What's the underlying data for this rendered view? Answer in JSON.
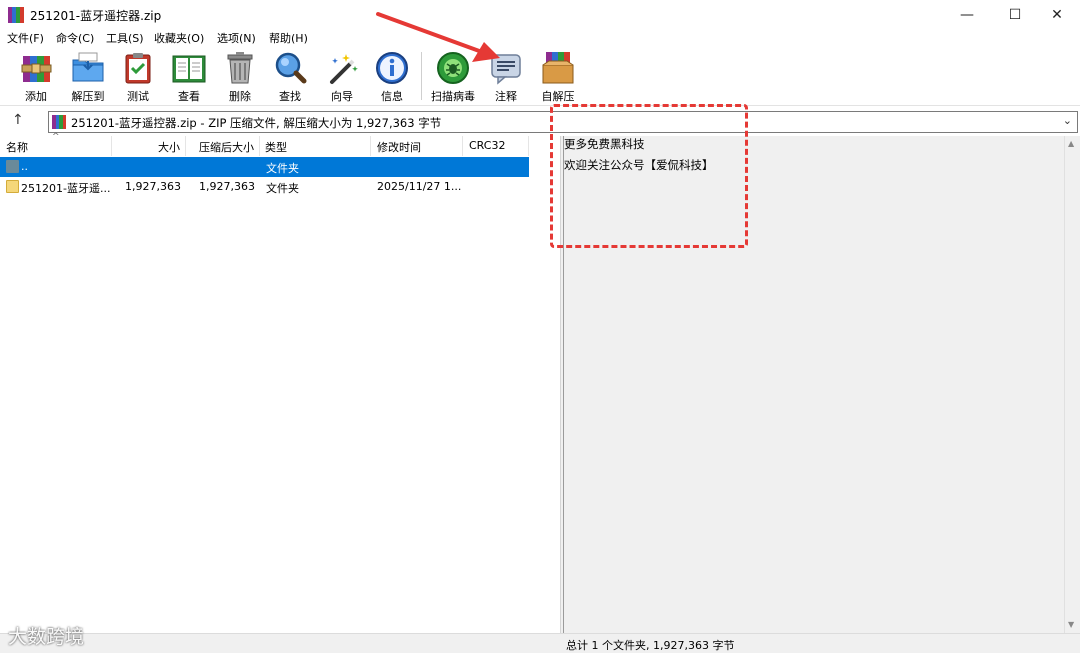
{
  "window": {
    "title": "251201-蓝牙遥控器.zip",
    "minimize_glyph": "—",
    "maximize_glyph": "☐",
    "close_glyph": "✕"
  },
  "menu": [
    "文件(F)",
    "命令(C)",
    "工具(S)",
    "收藏夹(O)",
    "选项(N)",
    "帮助(H)"
  ],
  "toolbar": [
    {
      "label": "添加",
      "icon": "add-archive-icon"
    },
    {
      "label": "解压到",
      "icon": "extract-folder-icon"
    },
    {
      "label": "测试",
      "icon": "test-clipboard-icon"
    },
    {
      "label": "查看",
      "icon": "view-book-icon"
    },
    {
      "label": "删除",
      "icon": "trash-icon"
    },
    {
      "label": "查找",
      "icon": "magnifier-icon"
    },
    {
      "label": "向导",
      "icon": "wizard-wand-icon"
    },
    {
      "label": "信息",
      "icon": "info-icon"
    },
    {
      "label": "扫描病毒",
      "icon": "virus-scan-icon"
    },
    {
      "label": "注释",
      "icon": "comment-icon"
    },
    {
      "label": "自解压",
      "icon": "sfx-box-icon"
    }
  ],
  "pathbar": {
    "up_glyph": "↑",
    "text": "251201-蓝牙遥控器.zip - ZIP 压缩文件, 解压缩大小为 1,927,363 字节",
    "dropdown_glyph": "⌄"
  },
  "columns": {
    "name": "名称",
    "size": "大小",
    "packed": "压缩后大小",
    "type": "类型",
    "modified": "修改时间",
    "crc": "CRC32",
    "sort_glyph": "^"
  },
  "rows": [
    {
      "name": "..",
      "size": "",
      "packed": "",
      "type": "文件夹",
      "modified": "",
      "crc": "",
      "selected": true
    },
    {
      "name": "251201-蓝牙遥...",
      "size": "1,927,363",
      "packed": "1,927,363",
      "type": "文件夹",
      "modified": "2025/11/27 1...",
      "crc": "",
      "selected": false
    }
  ],
  "comment": {
    "lines": [
      "更多免费黑科技",
      "欢迎关注公众号【爱侃科技】"
    ]
  },
  "scrollbar": {
    "up_glyph": "▲",
    "down_glyph": "▼"
  },
  "status": {
    "text": "总计 1 个文件夹, 1,927,363 字节"
  },
  "watermark": "大数跨境",
  "colors": {
    "selection": "#0078d7",
    "annotation": "#e53935",
    "folder": "#f5d77a",
    "panel": "#f0f0f0"
  }
}
